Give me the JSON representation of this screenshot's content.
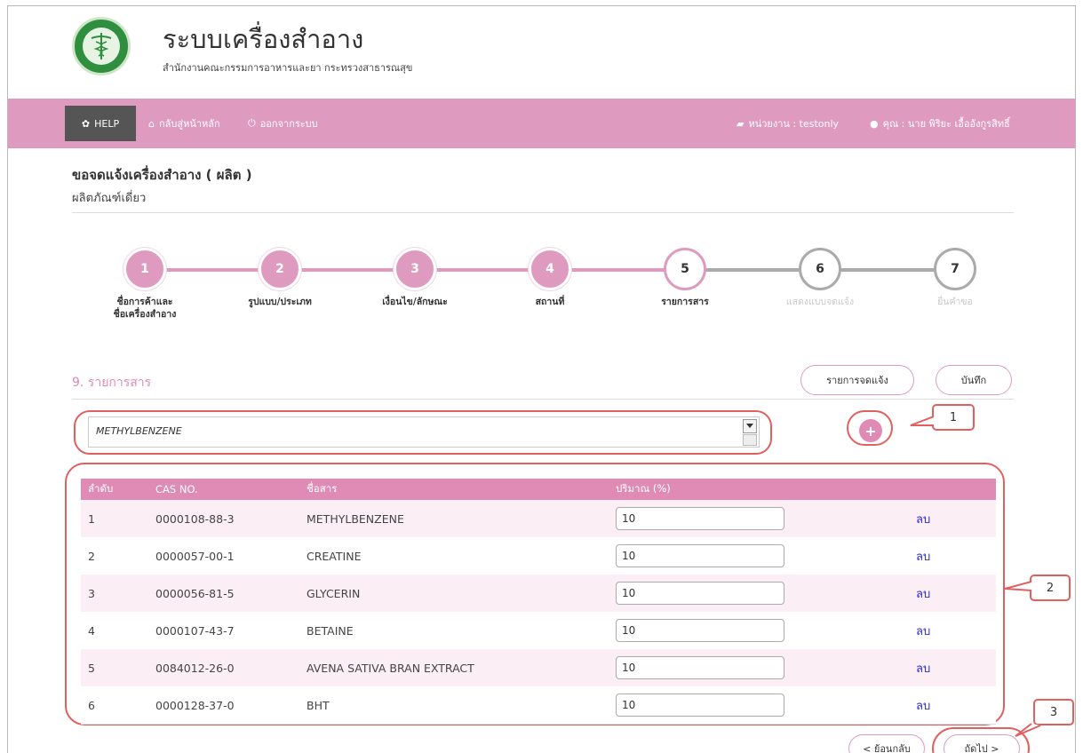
{
  "header": {
    "title": "ระบบเครื่องสำอาง",
    "subtitle": "สำนักงานคณะกรรมการอาหารและยา กระทรวงสาธารณสุข"
  },
  "navbar": {
    "help": "HELP",
    "home": "กลับสู่หน้าหลัก",
    "logout": "ออกจากระบบ",
    "agency": "หน่วยงาน : testonly",
    "user": "คุณ : นาย พิริยะ เอื้ออังกูรสิทธิ์"
  },
  "page": {
    "title": "ขอจดแจ้งเครื่องสำอาง ( ผลิต )",
    "subtitle": "ผลิตภัณฑ์เดี่ยว"
  },
  "steps": [
    {
      "num": "1",
      "label_line1": "ชื่อการค้าและ",
      "label_line2": "ชื่อเครื่องสำอาง",
      "state": "done"
    },
    {
      "num": "2",
      "label_line1": "รูปแบบ/ประเภท",
      "label_line2": "",
      "state": "done"
    },
    {
      "num": "3",
      "label_line1": "เงื่อนไข/ลักษณะ",
      "label_line2": "",
      "state": "done"
    },
    {
      "num": "4",
      "label_line1": "สถานที่",
      "label_line2": "",
      "state": "done"
    },
    {
      "num": "5",
      "label_line1": "รายการสาร",
      "label_line2": "",
      "state": "active"
    },
    {
      "num": "6",
      "label_line1": "แสดงแบบจดแจ้ง",
      "label_line2": "",
      "state": "todo"
    },
    {
      "num": "7",
      "label_line1": "ยื่นคำขอ",
      "label_line2": "",
      "state": "todo"
    }
  ],
  "section": {
    "title": "9. รายการสาร",
    "list_button": "รายการจดแจ้ง",
    "save_button": "บันทึก",
    "select_value": "METHYLBENZENE"
  },
  "table": {
    "headers": {
      "no": "ลำดับ",
      "cas": "CAS NO.",
      "name": "ชื่อสาร",
      "amount": "ปริมาณ (%)"
    },
    "rows": [
      {
        "no": "1",
        "cas": "0000108-88-3",
        "name": "METHYLBENZENE",
        "amount": "10",
        "delete": "ลบ"
      },
      {
        "no": "2",
        "cas": "0000057-00-1",
        "name": "CREATINE",
        "amount": "10",
        "delete": "ลบ"
      },
      {
        "no": "3",
        "cas": "0000056-81-5",
        "name": "GLYCERIN",
        "amount": "10",
        "delete": "ลบ"
      },
      {
        "no": "4",
        "cas": "0000107-43-7",
        "name": "BETAINE",
        "amount": "10",
        "delete": "ลบ"
      },
      {
        "no": "5",
        "cas": "0084012-26-0",
        "name": "AVENA SATIVA BRAN EXTRACT",
        "amount": "10",
        "delete": "ลบ"
      },
      {
        "no": "6",
        "cas": "0000128-37-0",
        "name": "BHT",
        "amount": "10",
        "delete": "ลบ"
      }
    ]
  },
  "footer": {
    "back_button": "< ย้อนกลับ",
    "next_button": "ถัดไป >"
  },
  "callouts": {
    "one": "1",
    "two": "2",
    "three": "3"
  },
  "colors": {
    "accent": "#df9bbf",
    "accent_dark": "#df8bb6",
    "callout_red": "#e06060",
    "row_alt": "#fbeef5"
  }
}
